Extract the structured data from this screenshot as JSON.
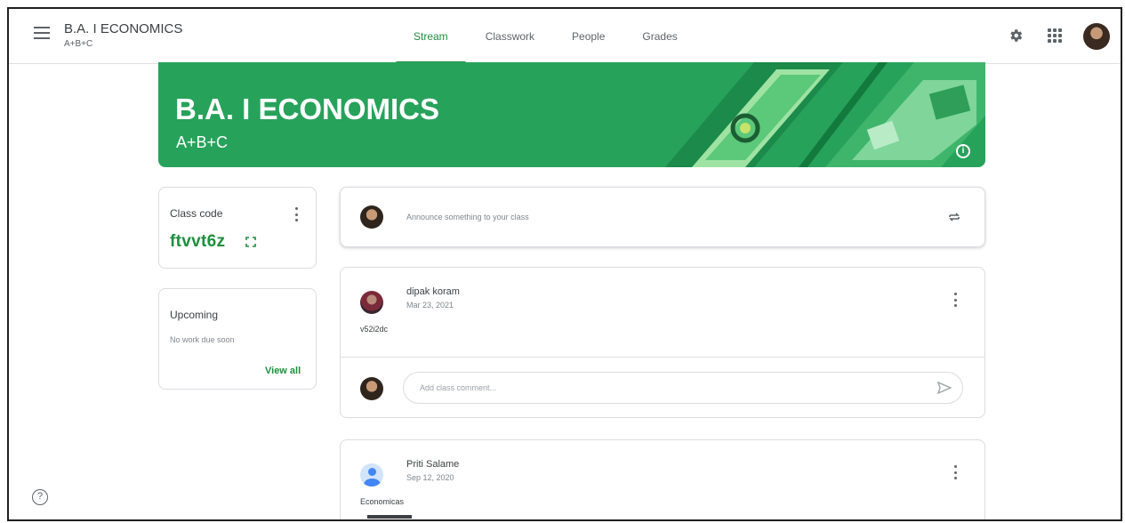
{
  "header": {
    "class_title": "B.A. I ECONOMICS",
    "class_subtitle": "A+B+C",
    "tabs": [
      {
        "label": "Stream",
        "active": true
      },
      {
        "label": "Classwork",
        "active": false
      },
      {
        "label": "People",
        "active": false
      },
      {
        "label": "Grades",
        "active": false
      }
    ],
    "icons": [
      "menu-icon",
      "gear-icon",
      "apps-icon",
      "account-avatar"
    ]
  },
  "banner": {
    "title": "B.A. I ECONOMICS",
    "subtitle": "A+B+C",
    "color": "#27a25b",
    "info_icon": "info-icon"
  },
  "class_code": {
    "label": "Class code",
    "value": "ftvvt6z"
  },
  "upcoming": {
    "title": "Upcoming",
    "empty_text": "No work due soon",
    "view_all": "View all"
  },
  "announce": {
    "placeholder": "Announce something to your class"
  },
  "posts": [
    {
      "author": "dipak koram",
      "date": "Mar 23, 2021",
      "body": "v52i2dc",
      "comment_placeholder": "Add class comment..."
    },
    {
      "author": "Priti Salame",
      "date": "Sep 12, 2020",
      "body": "Economicas"
    }
  ],
  "colors": {
    "accent": "#1e8e3e",
    "banner": "#27a25b"
  }
}
